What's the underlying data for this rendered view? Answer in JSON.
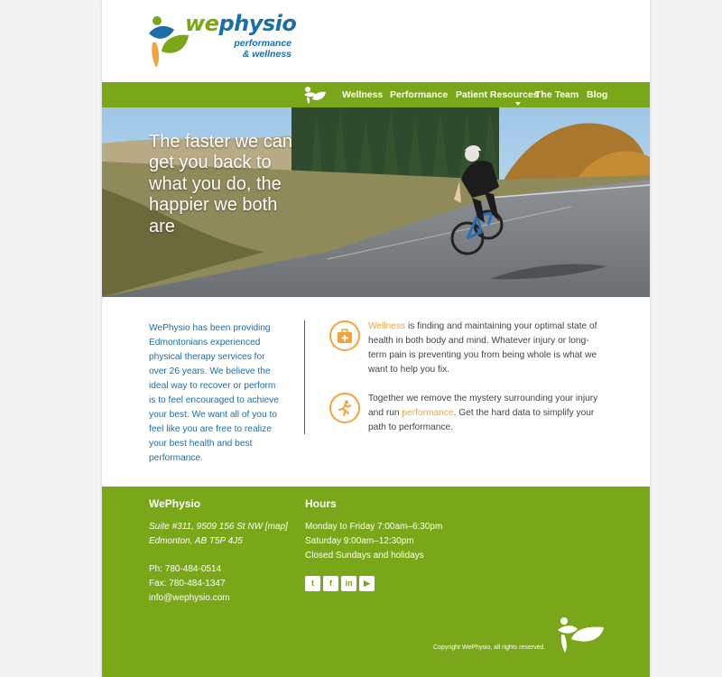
{
  "brand": {
    "name_we": "we",
    "name_physio": "physio",
    "tagline_1": "performance",
    "tagline_2": "& wellness",
    "colors": {
      "green": "#7aa619",
      "blue": "#1b6fa8",
      "orange": "#f2a43a"
    }
  },
  "nav": {
    "icon": "leaf-figure-icon",
    "items": [
      {
        "label": "Wellness"
      },
      {
        "label": "Performance"
      },
      {
        "label": "Patient Resources",
        "has_dropdown": true
      },
      {
        "label": "The Team"
      },
      {
        "label": "Blog"
      }
    ]
  },
  "hero": {
    "headline": "The faster we can get you back to what you do, the happier we both are"
  },
  "intro": {
    "text": "WePhysio has been providing Edmontonians experienced physical therapy services for over 26 years. We believe the ideal way to recover or perform is to feel encouraged to achieve your best. We want all of you to feel like you are free to realize your best health and best performance."
  },
  "features": [
    {
      "icon": "first-aid-kit-icon",
      "link": "Wellness",
      "text_after": " is finding and maintaining your optimal state of health in both body and mind. Whatever injury or long-term pain is preventing you from being whole is what we want to help you fix."
    },
    {
      "icon": "runner-icon",
      "text_before": "Together we remove the mystery surrounding your injury and run ",
      "link": "performance",
      "text_after": ". Get the hard data to simplify your path to performance."
    }
  ],
  "footer": {
    "contact_heading": "WePhysio",
    "address_1": "Suite #311, 9509 156 St NW [map]",
    "address_2": "Edmonton, AB T5P 4J5",
    "phone": "Ph: 780-484-0514",
    "fax": "Fax: 780-484-1347",
    "email": "info@wephysio.com",
    "hours_heading": "Hours",
    "hours_1": "Monday to Friday 7:00am–6:30pm",
    "hours_2": "Saturday 9:00am–12:30pm",
    "hours_3": "Closed Sundays and holidays",
    "social": [
      {
        "icon": "twitter-icon",
        "glyph": "t"
      },
      {
        "icon": "facebook-icon",
        "glyph": "f"
      },
      {
        "icon": "linkedin-icon",
        "glyph": "in"
      },
      {
        "icon": "youtube-icon",
        "glyph": "▶"
      }
    ],
    "copyright": "Copyright WePhysio, all rights reserved."
  }
}
